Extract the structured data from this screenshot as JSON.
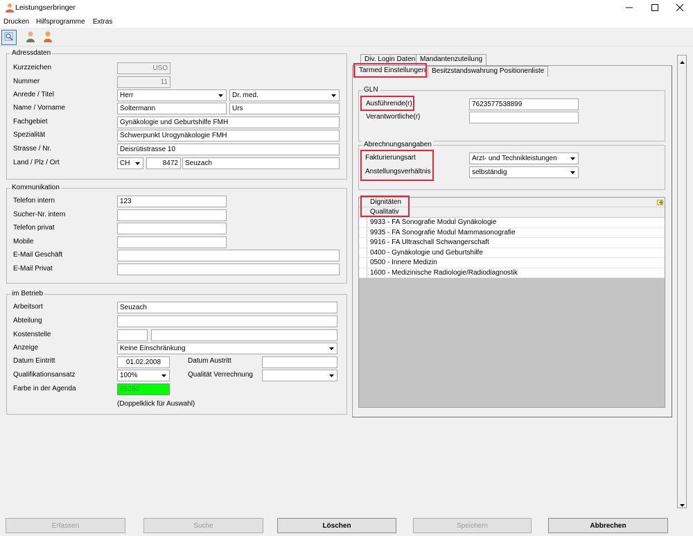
{
  "window": {
    "title": "Leistungserbringer"
  },
  "menu": {
    "items": [
      "Drucken",
      "Hilfsprogramme",
      "Extras"
    ]
  },
  "address": {
    "title": "Adressdaten",
    "kurzzeichen_label": "Kurzzeichen",
    "kurzzeichen": "USO",
    "nummer_label": "Nummer",
    "nummer": "11",
    "anrede_label": "Anrede / Titel",
    "anrede": "Herr",
    "titel": "Dr. med.",
    "name_label": "Name / Vorname",
    "name": "Soltermann",
    "vorname": "Urs",
    "fachgebiet_label": "Fachgebiet",
    "fachgebiet": "Gynäkologie und Geburtshilfe FMH",
    "spezialitaet_label": "Spezialität",
    "spezialitaet": "Schwerpunkt Urogynäkologie FMH",
    "strasse_label": "Strasse / Nr.",
    "strasse": "Deisrütistrasse 10",
    "land_label": "Land / Plz / Ort",
    "land": "CH",
    "plz": "8472",
    "ort": "Seuzach"
  },
  "communication": {
    "title": "Kommunikation",
    "telefon_intern_label": "Telefon intern",
    "telefon_intern": "123",
    "sucher_label": "Sucher-Nr. intern",
    "sucher": "",
    "telefon_privat_label": "Telefon privat",
    "telefon_privat": "",
    "mobile_label": "Mobile",
    "mobile": "",
    "email_geschaeft_label": "E-Mail Geschäft",
    "email_geschaeft": "",
    "email_privat_label": "E-Mail Privat",
    "email_privat": ""
  },
  "business": {
    "title": "im Betrieb",
    "arbeitsort_label": "Arbeitsort",
    "arbeitsort": "Seuzach",
    "abteilung_label": "Abteilung",
    "abteilung": "",
    "kostenstelle_label": "Kostenstelle",
    "kostenstelle_code": "",
    "kostenstelle_name": "",
    "anzeige_label": "Anzeige",
    "anzeige": "Keine Einschränkung",
    "eintritt_label": "Datum Eintritt",
    "eintritt": "01.02.2008",
    "austritt_label": "Datum Austritt",
    "austritt": "",
    "qualifikation_label": "Qualifikationsansatz",
    "qualifikation": "100%",
    "qualitaet_label": "Qualität Verrechnung",
    "qualitaet": "",
    "farbe_label": "Farbe in der Agenda",
    "farbe": "65280",
    "farbe_color": "#00ff00",
    "farbe_hint": "(Doppelklick für Auswahl)"
  },
  "tabs": {
    "row1": [
      "Div. Login Daten",
      "Mandantenzuteilung"
    ],
    "row2": [
      "Tarmed Einstellungen",
      "Besitzstandswahrung Positionenliste"
    ]
  },
  "gln": {
    "title": "GLN",
    "ausfuehrende_label": "Ausführende(r)",
    "ausfuehrende": "7623577538899",
    "verantwortliche_label": "Verantwortliche(r)",
    "verantwortliche": ""
  },
  "billing": {
    "title": "Abrechnungsangaben",
    "fakturierungsart_label": "Fakturierungsart",
    "fakturierungsart": "Arzt- und Technikleistungen",
    "anstellung_label": "Anstellungsverhältnis",
    "anstellung": "selbständig"
  },
  "dignitaeten": {
    "header": "Dignitäten",
    "subheader": "Qualitativ",
    "rows": [
      "9933 - FA  Sonografie Modul Gynäkologie",
      "9935 - FA Sonografie Modul Mammasonografie",
      "9916 - FA Ultraschall Schwangerschaft",
      "0400 - Gynäkologie und Geburtshilfe",
      "0500 - Innere Medizin",
      "1600 - Medizinische Radiologie/Radiodiagnostik"
    ]
  },
  "buttons": {
    "erfassen": "Erfassen",
    "suche": "Suche",
    "loeschen": "Löschen",
    "speichern": "Speichern",
    "abbrechen": "Abbrechen"
  },
  "colors": {
    "highlight": "#e3263b",
    "grid_empty": "#c4c4c4"
  }
}
